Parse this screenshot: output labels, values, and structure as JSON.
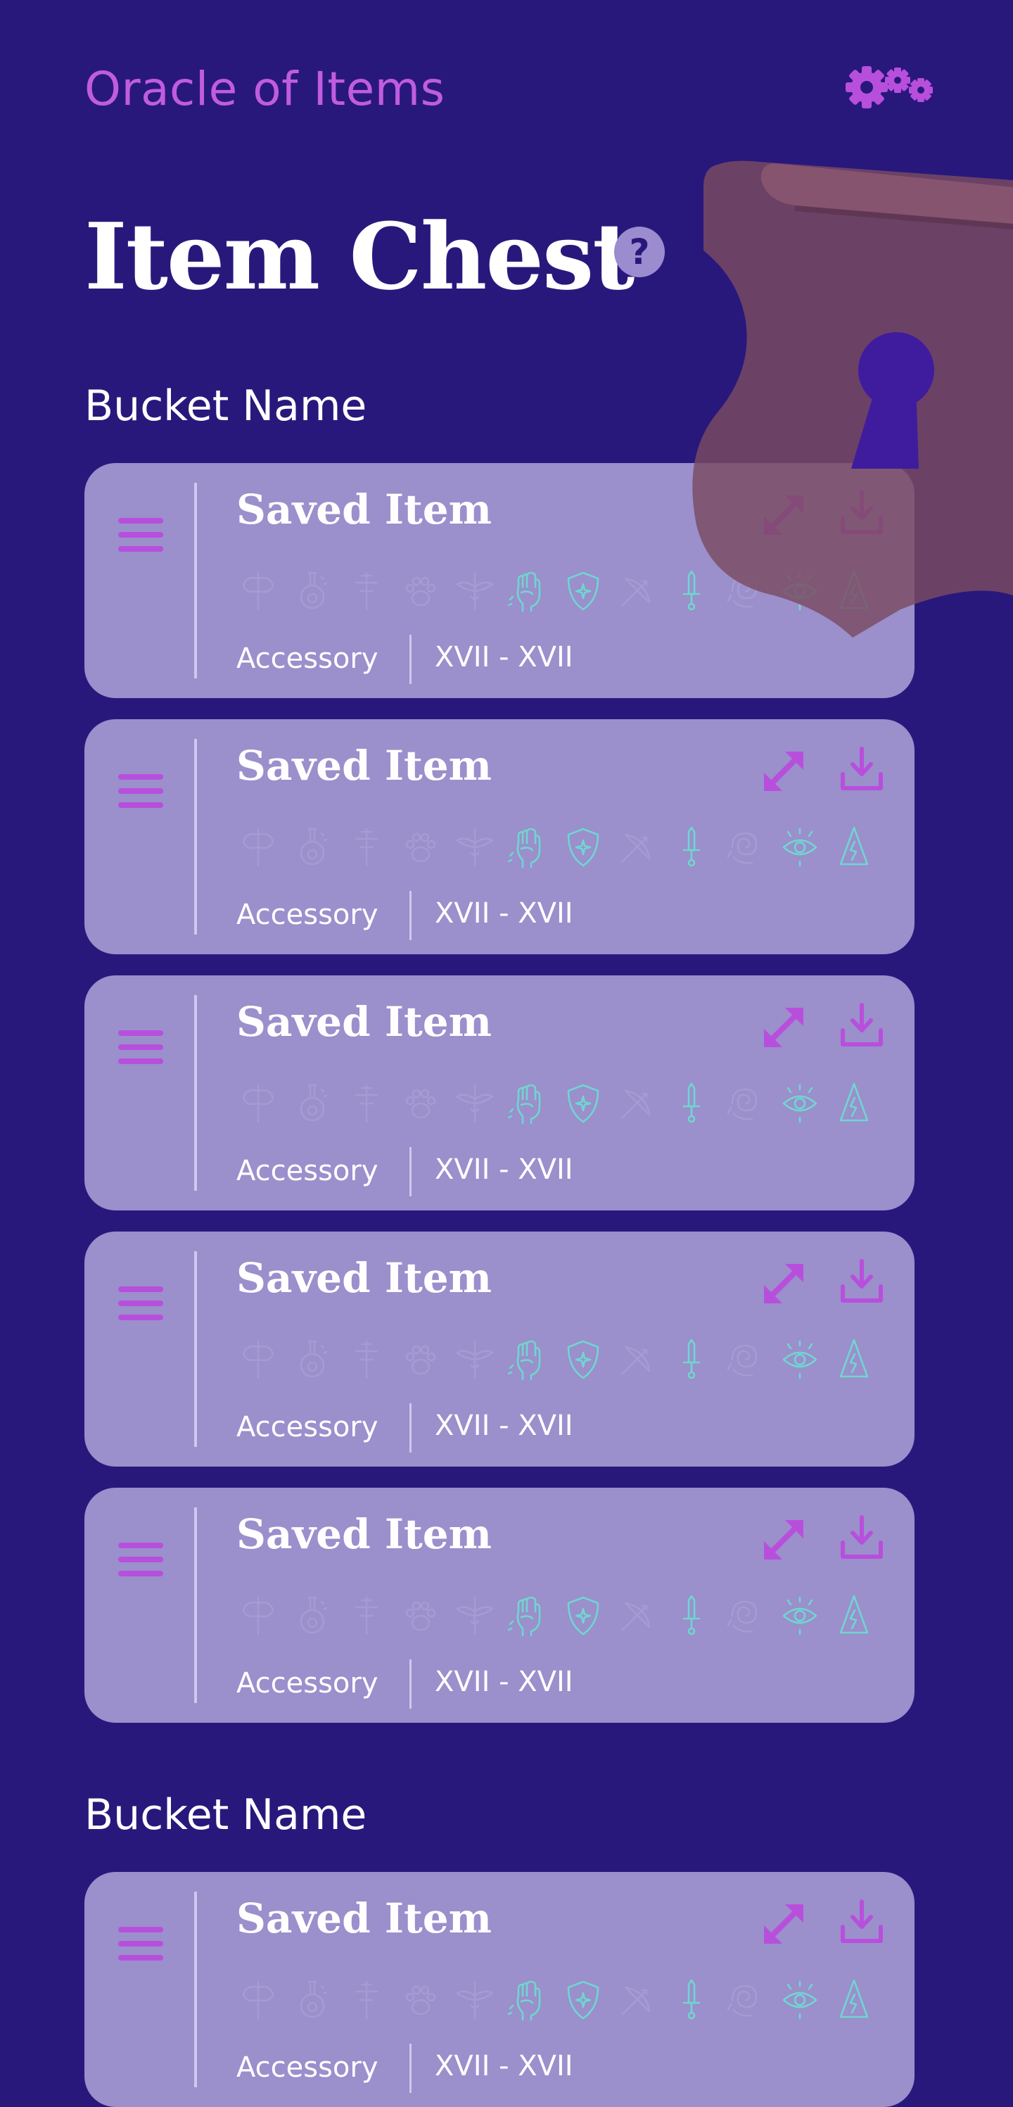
{
  "app": {
    "title": "Oracle of Items",
    "settings_icon": "gears-icon"
  },
  "page": {
    "title": "Item Chest",
    "help_label": "?"
  },
  "colors": {
    "background": "#29187c",
    "accent": "#c05ce0",
    "card": "#9b8fcc",
    "icon_active": "#6fd6d0",
    "icon_inactive": "#a69bd2",
    "chest": "#6b4566"
  },
  "buckets": [
    {
      "name": "Bucket Name",
      "items": [
        {
          "title": "Saved Item",
          "category": "Accessory",
          "range": "XVII - XVII"
        },
        {
          "title": "Saved Item",
          "category": "Accessory",
          "range": "XVII - XVII"
        },
        {
          "title": "Saved Item",
          "category": "Accessory",
          "range": "XVII - XVII"
        },
        {
          "title": "Saved Item",
          "category": "Accessory",
          "range": "XVII - XVII"
        },
        {
          "title": "Saved Item",
          "category": "Accessory",
          "range": "XVII - XVII"
        }
      ]
    },
    {
      "name": "Bucket Name",
      "items": [
        {
          "title": "Saved Item",
          "category": "Accessory",
          "range": "XVII - XVII"
        }
      ]
    }
  ],
  "attribute_icons": [
    {
      "name": "axe-icon",
      "active": false
    },
    {
      "name": "potion-icon",
      "active": false
    },
    {
      "name": "cross-icon",
      "active": false
    },
    {
      "name": "paw-icon",
      "active": false
    },
    {
      "name": "winged-staff-icon",
      "active": false
    },
    {
      "name": "fist-icon",
      "active": true
    },
    {
      "name": "shield-icon",
      "active": true
    },
    {
      "name": "bow-icon",
      "active": false
    },
    {
      "name": "dagger-icon",
      "active": true
    },
    {
      "name": "spiral-icon",
      "active": false
    },
    {
      "name": "eye-icon",
      "active": true
    },
    {
      "name": "wizard-hat-icon",
      "active": true
    }
  ]
}
